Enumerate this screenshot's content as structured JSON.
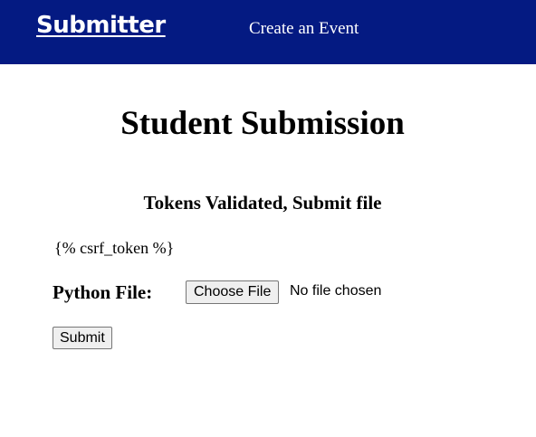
{
  "navbar": {
    "brand": "Submitter",
    "link": "Create an Event",
    "background_color": "#041a82"
  },
  "main": {
    "title": "Student Submission",
    "subtitle": "Tokens Validated, Submit file",
    "template_text": "{% csrf_token %}",
    "file_label": "Python File:",
    "file_button": "Choose File",
    "file_status": "No file chosen",
    "submit_button": "Submit"
  }
}
